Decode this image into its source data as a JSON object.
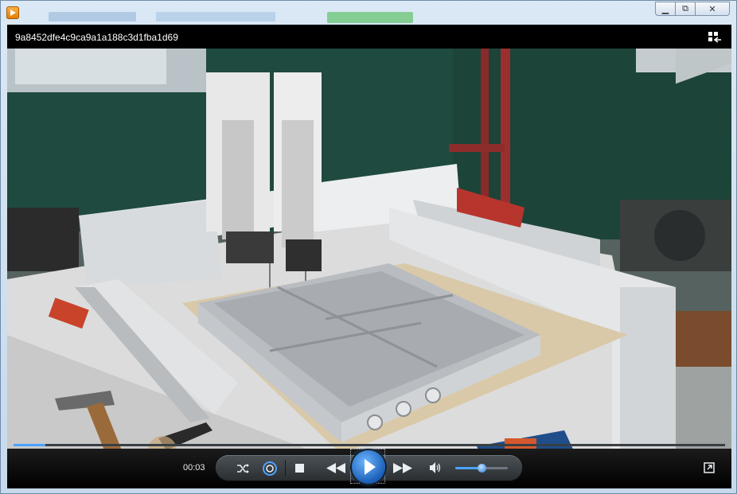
{
  "window": {
    "caption_minimize": "▁",
    "caption_restore": "⧉",
    "caption_close": "✕"
  },
  "player": {
    "video_title": "9a8452dfe4c9ca9a1a188c3d1fba1d69",
    "current_time": "00:03",
    "progress_fraction": 0.045,
    "volume_fraction": 0.5
  },
  "controls": {
    "shuffle_icon": "shuffle-icon",
    "repeat_icon": "repeat-icon",
    "stop_icon": "stop-icon",
    "previous_icon": "previous-icon",
    "play_icon": "play-icon",
    "next_icon": "next-icon",
    "mute_icon": "speaker-icon",
    "switch_to_library_icon": "switch-to-library-icon",
    "fullscreen_icon": "fullscreen-icon"
  },
  "colors": {
    "accent": "#4aa3ff",
    "control_bar": "#000000"
  }
}
